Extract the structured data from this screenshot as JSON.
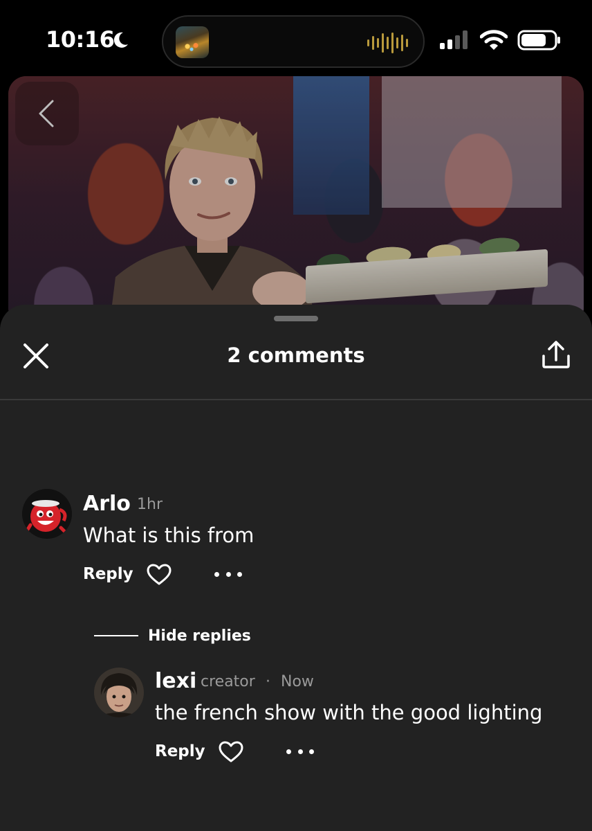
{
  "status_bar": {
    "time": "10:16",
    "focus_icon": "moon-icon",
    "island_activity": "audio-playing",
    "signal_bars_active": 2,
    "signal_bars_total": 4,
    "wifi": "wifi-icon",
    "battery_level": 0.75
  },
  "video": {
    "back_icon": "chevron-left-icon"
  },
  "sheet": {
    "title": "2 comments",
    "close_icon": "close-icon",
    "share_icon": "share-upload-icon"
  },
  "comments": [
    {
      "author": "Arlo",
      "time": "1hr",
      "text": "What is this from",
      "reply_label": "Reply",
      "avatar": "kool-aid-man-avatar"
    }
  ],
  "thread": {
    "toggle_label": "Hide replies"
  },
  "replies": [
    {
      "author": "lexi",
      "badge": "creator",
      "separator": "·",
      "time": "Now",
      "text": "the french show with the good lighting",
      "reply_label": "Reply",
      "avatar": "user-photo-avatar"
    }
  ],
  "colors": {
    "sheet_bg": "#222222",
    "divider": "#3a3a3a",
    "meta_text": "#9a9a9a",
    "audio_wave": "#b99a3c"
  }
}
